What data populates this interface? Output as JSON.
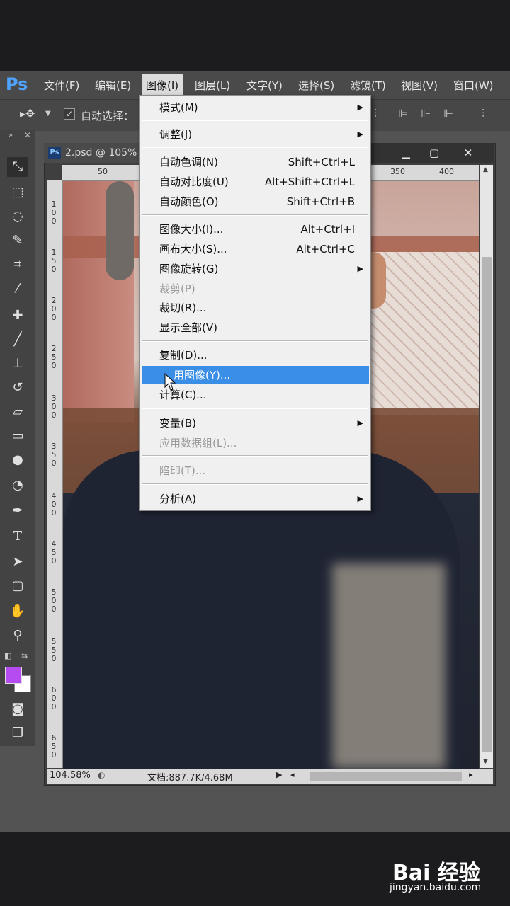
{
  "app": {
    "logo": "Ps"
  },
  "menubar": {
    "items": [
      "文件(F)",
      "编辑(E)",
      "图像(I)",
      "图层(L)",
      "文字(Y)",
      "选择(S)",
      "滤镜(T)",
      "视图(V)",
      "窗口(W)"
    ],
    "active_index": 2
  },
  "options_bar": {
    "auto_select_label": "自动选择："
  },
  "document": {
    "tab_title": "2.psd @ 105%",
    "badge": "Ps",
    "ruler_top": [
      "50",
      "350",
      "400"
    ],
    "ruler_left": [
      "1\n0\n0",
      "1\n5\n0",
      "2\n0\n0",
      "2\n5\n0",
      "3\n0\n0",
      "3\n5\n0",
      "4\n0\n0",
      "4\n5\n0",
      "5\n0\n0",
      "5\n5\n0",
      "6\n0\n0",
      "6\n5\n0"
    ],
    "zoom": "104.58%",
    "doc_info": "文档:887.7K/4.68M"
  },
  "image_menu": {
    "items": [
      {
        "label": "模式(M)",
        "shortcut": "",
        "submenu": true,
        "disabled": false
      },
      {
        "label": "调整(J)",
        "shortcut": "",
        "submenu": true,
        "disabled": false
      },
      {
        "label": "自动色调(N)",
        "shortcut": "Shift+Ctrl+L",
        "submenu": false,
        "disabled": false
      },
      {
        "label": "自动对比度(U)",
        "shortcut": "Alt+Shift+Ctrl+L",
        "submenu": false,
        "disabled": false
      },
      {
        "label": "自动颜色(O)",
        "shortcut": "Shift+Ctrl+B",
        "submenu": false,
        "disabled": false
      },
      {
        "label": "图像大小(I)...",
        "shortcut": "Alt+Ctrl+I",
        "submenu": false,
        "disabled": false
      },
      {
        "label": "画布大小(S)...",
        "shortcut": "Alt+Ctrl+C",
        "submenu": false,
        "disabled": false
      },
      {
        "label": "图像旋转(G)",
        "shortcut": "",
        "submenu": true,
        "disabled": false
      },
      {
        "label": "裁剪(P)",
        "shortcut": "",
        "submenu": false,
        "disabled": true
      },
      {
        "label": "裁切(R)...",
        "shortcut": "",
        "submenu": false,
        "disabled": false
      },
      {
        "label": "显示全部(V)",
        "shortcut": "",
        "submenu": false,
        "disabled": false
      },
      {
        "label": "复制(D)...",
        "shortcut": "",
        "submenu": false,
        "disabled": false
      },
      {
        "label": "用图像(Y)...",
        "shortcut": "",
        "submenu": false,
        "disabled": false,
        "highlighted": true
      },
      {
        "label": "计算(C)...",
        "shortcut": "",
        "submenu": false,
        "disabled": false
      },
      {
        "label": "变量(B)",
        "shortcut": "",
        "submenu": true,
        "disabled": false
      },
      {
        "label": "应用数据组(L)...",
        "shortcut": "",
        "submenu": false,
        "disabled": true
      },
      {
        "label": "陷印(T)...",
        "shortcut": "",
        "submenu": false,
        "disabled": true
      },
      {
        "label": "分析(A)",
        "shortcut": "",
        "submenu": true,
        "disabled": false
      }
    ]
  },
  "watermark": {
    "logo": "Bai 经验",
    "url": "jingyan.baidu.com"
  },
  "colors": {
    "highlight": "#3a8ee6",
    "foreground_swatch": "#b44cf2",
    "ps_blue": "#4fa3ff"
  }
}
